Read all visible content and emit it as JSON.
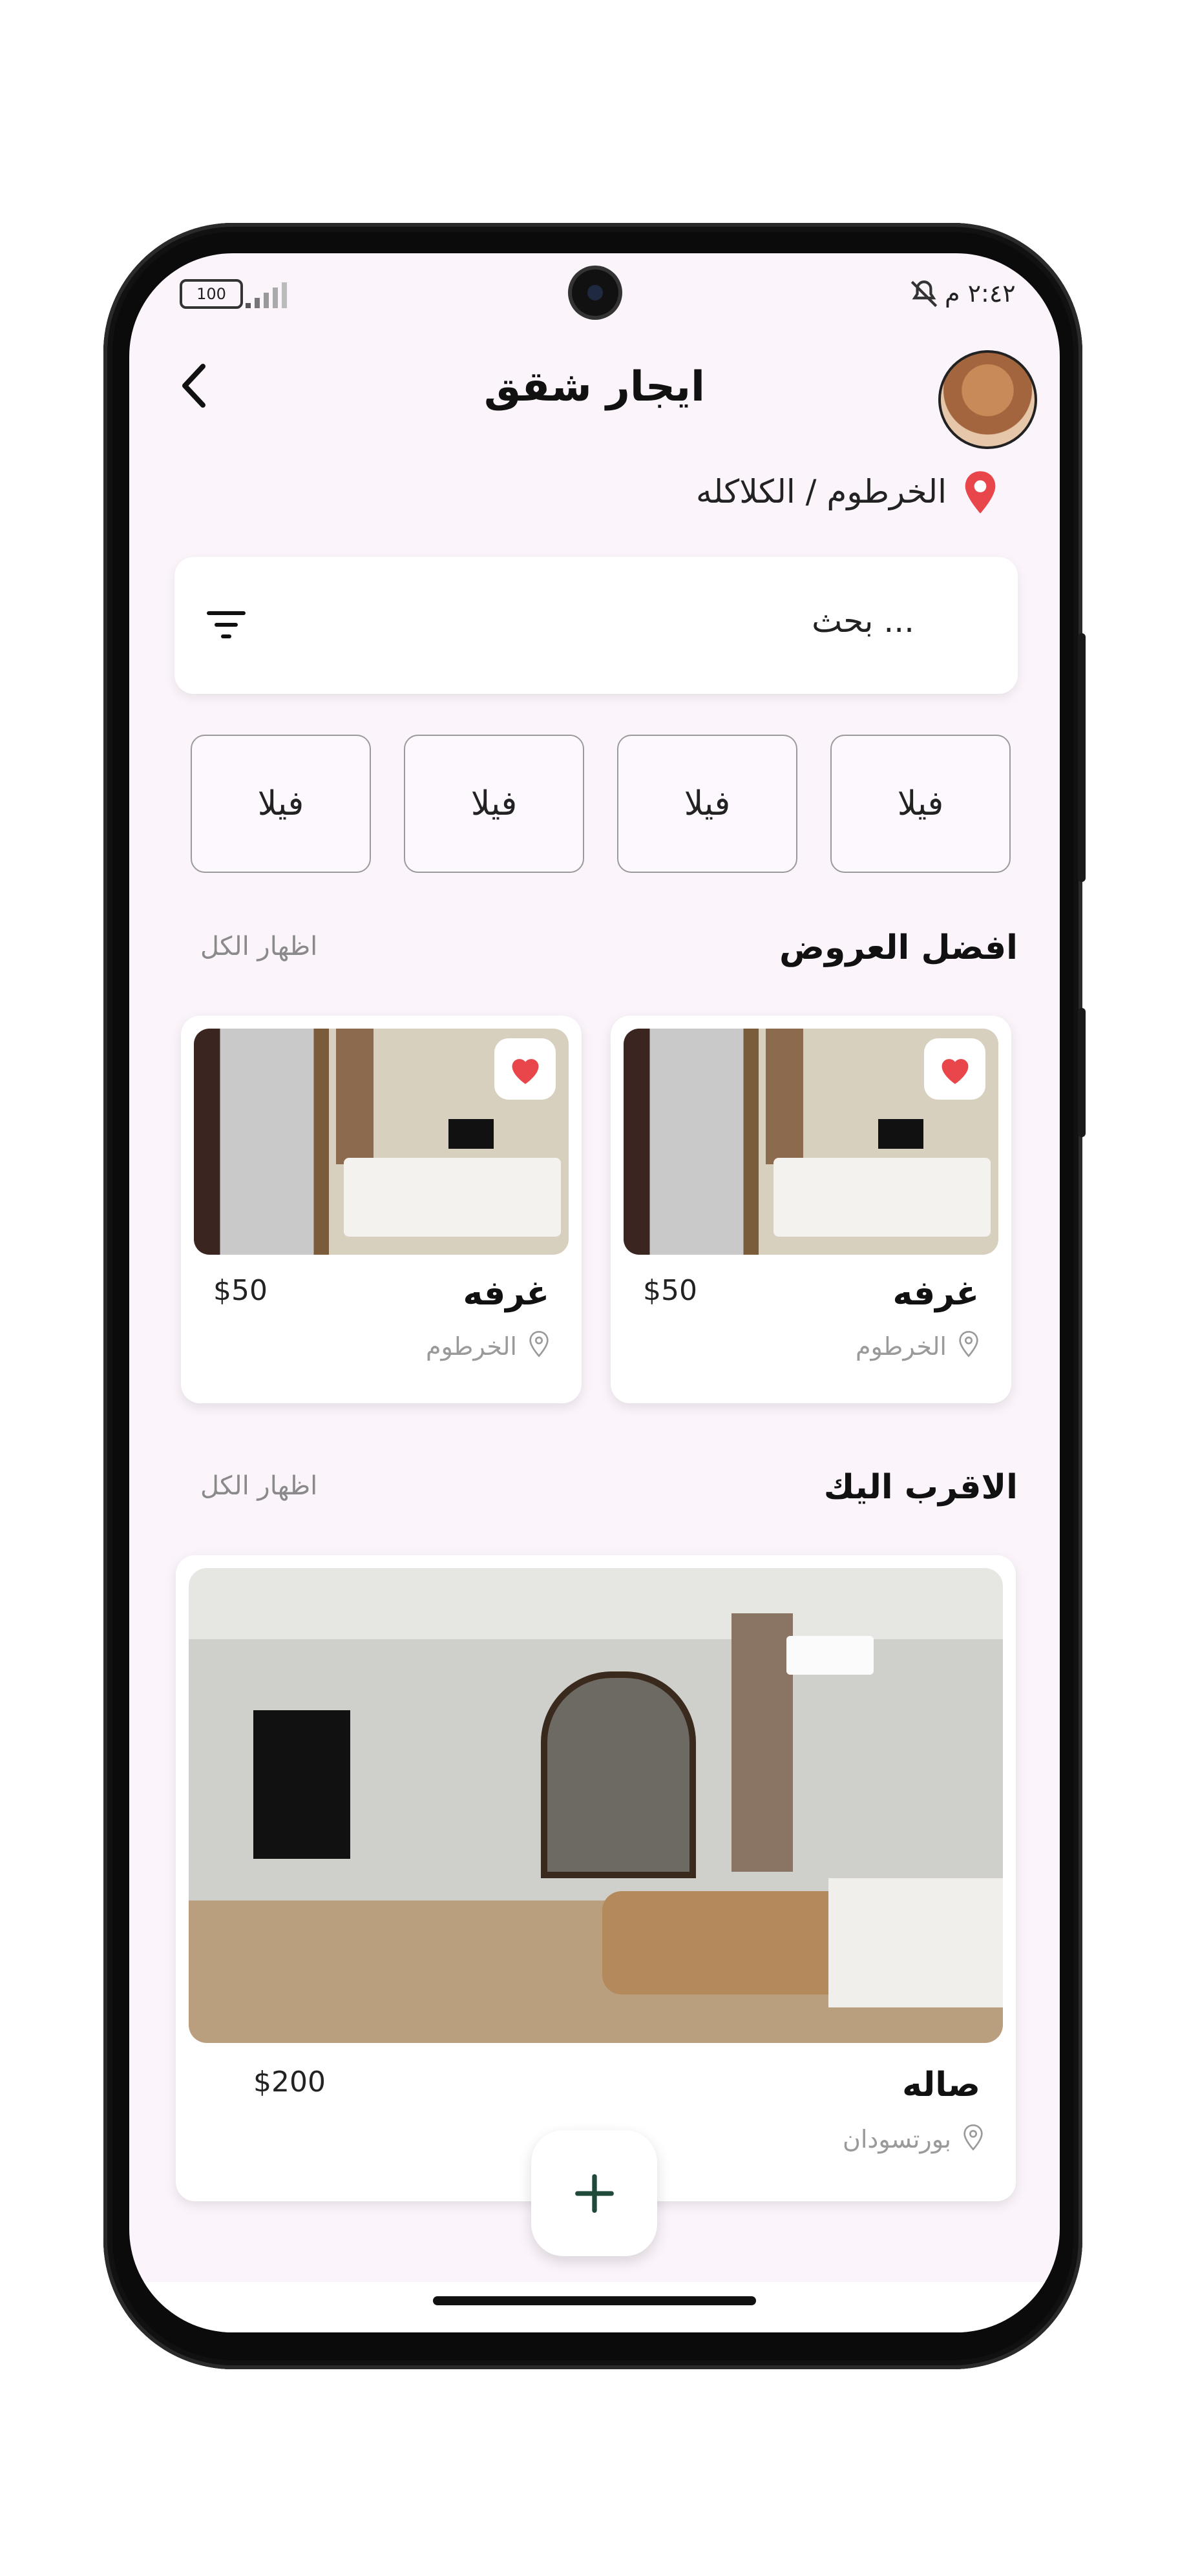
{
  "status_bar": {
    "time": "٢:٤٢ م",
    "battery": "100"
  },
  "header": {
    "title": "ايجار شقق"
  },
  "location": {
    "text": "الخرطوم / الكلاكله"
  },
  "search": {
    "placeholder": "بحث ..."
  },
  "categories": [
    {
      "label": "فيلا"
    },
    {
      "label": "فيلا"
    },
    {
      "label": "فيلا"
    },
    {
      "label": "فيلا"
    }
  ],
  "best_offers": {
    "title": "افضل العروض",
    "show_all": "اظهار الكل",
    "items": [
      {
        "name": "غرفه",
        "price": "$50",
        "location": "الخرطوم",
        "favorite": true
      },
      {
        "name": "غرفه",
        "price": "$50",
        "location": "الخرطوم",
        "favorite": true
      }
    ]
  },
  "nearest": {
    "title": "الاقرب اليك",
    "show_all": "اظهار الكل",
    "items": [
      {
        "name": "صاله",
        "price": "$200",
        "location": "بورتسودان"
      }
    ]
  },
  "colors": {
    "accent": "#e8464a",
    "fab_plus": "#1f4a3a",
    "background": "#fbf5fb"
  },
  "icons": {
    "back": "chevron-left-icon",
    "filter": "filter-icon",
    "location": "map-pin-icon",
    "favorite": "heart-icon",
    "add": "plus-icon"
  }
}
